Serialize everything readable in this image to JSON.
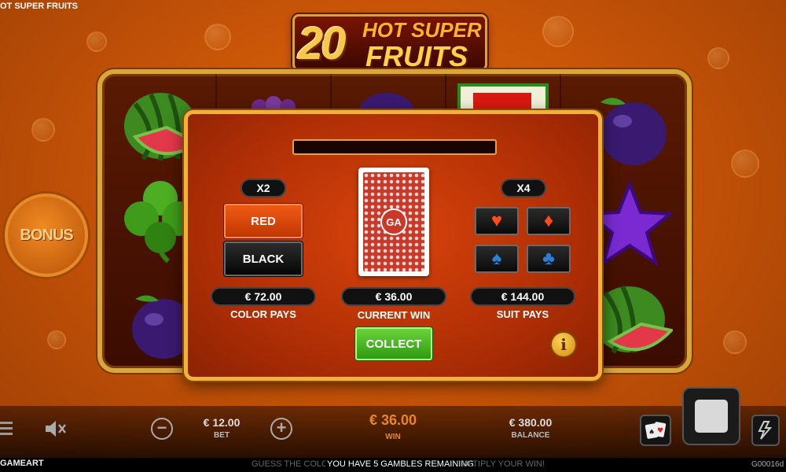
{
  "game": {
    "title_small": "OT SUPER FRUITS",
    "logo_number": "20",
    "logo_line1": "HOT SUPER",
    "logo_line2": "FRUITS",
    "bonus_label": "BONUS"
  },
  "gamble": {
    "message": "",
    "color_multiplier": "X2",
    "suit_multiplier": "X4",
    "red_label": "RED",
    "black_label": "BLACK",
    "color_pays_value": "€ 72.00",
    "color_pays_label": "COLOR PAYS",
    "current_win_value": "€ 36.00",
    "current_win_label": "CURRENT WIN",
    "suit_pays_value": "€ 144.00",
    "suit_pays_label": "SUIT PAYS",
    "collect_label": "COLLECT",
    "card_logo": "GA",
    "info_label": "i",
    "suits": [
      {
        "name": "hearts",
        "glyph": "♥",
        "color": "#ff4a1a"
      },
      {
        "name": "diamonds",
        "glyph": "♦",
        "color": "#ff4a1a"
      },
      {
        "name": "spades",
        "glyph": "♠",
        "color": "#2c7fd8"
      },
      {
        "name": "clubs",
        "glyph": "♣",
        "color": "#2c7fd8"
      }
    ]
  },
  "bottom": {
    "bet_value": "€ 12.00",
    "bet_label": "BET",
    "win_value": "€ 36.00",
    "win_label": "WIN",
    "balance_value": "€ 380.00",
    "balance_label": "BALANCE",
    "minus_label": "−",
    "plus_label": "+",
    "ticker_left": "GUESS THE COLOU",
    "ticker_main": "YOU HAVE 5 GAMBLES REMAINING.",
    "ticker_right": "ULTIPLY YOUR WIN!",
    "brand": "GAMEART",
    "game_id": "G00016d"
  },
  "colors": {
    "background": "#c95508",
    "frame_gold": "#d9a63c",
    "win_orange": "#e8862a",
    "collect_green": "#3fb51a"
  },
  "icons": [
    "menu-icon",
    "mute-icon",
    "cards-icon",
    "lightning-icon",
    "stop-icon"
  ]
}
